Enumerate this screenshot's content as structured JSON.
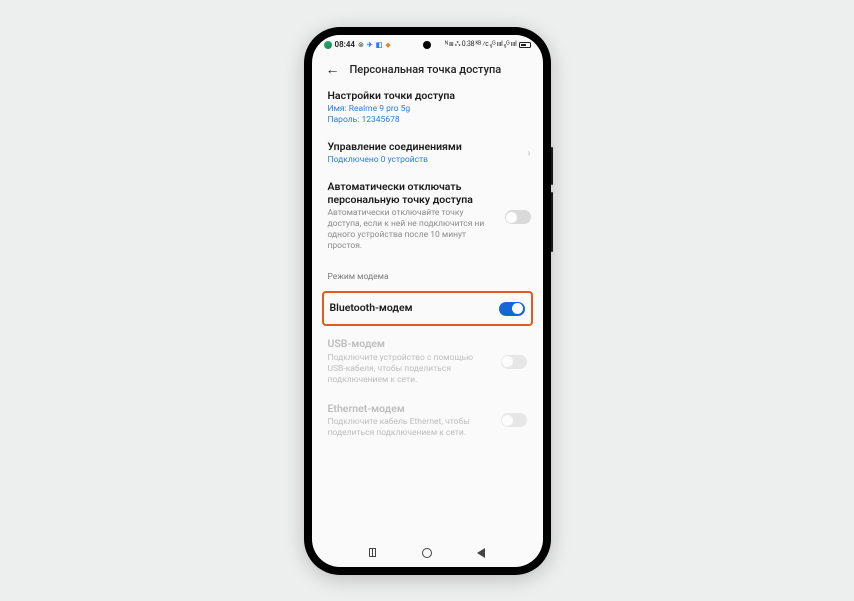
{
  "statusbar": {
    "time": "08:44",
    "right_text": "ᴺ ⧈ ⁂ 0.38 ᴷᴮ ⁄ᴄ ₅ᴳ ıııl ₅ᴳ ıııl"
  },
  "header": {
    "title": "Персональная точка доступа"
  },
  "hotspot_settings": {
    "title": "Настройки точки доступа",
    "name_line": "Имя: Realme 9 pro 5g",
    "password_line": "Пароль: 12345678"
  },
  "connections": {
    "title": "Управление соединениями",
    "subtitle": "Подключено 0 устройств"
  },
  "auto_off": {
    "title": "Автоматически отключать персональную точку доступа",
    "desc": "Автоматически отключайте точку доступа, если к ней не подключится ни одного устройства после 10 минут простоя."
  },
  "section_modem": "Режим модема",
  "bt_modem": {
    "title": "Bluetooth-модем"
  },
  "usb_modem": {
    "title": "USB-модем",
    "desc": "Подключите устройство с помощью USB-кабеля, чтобы поделиться подключением к сети."
  },
  "eth_modem": {
    "title": "Ethernet-модем",
    "desc": "Подключите кабель Ethernet, чтобы поделиться подключением к сети."
  }
}
